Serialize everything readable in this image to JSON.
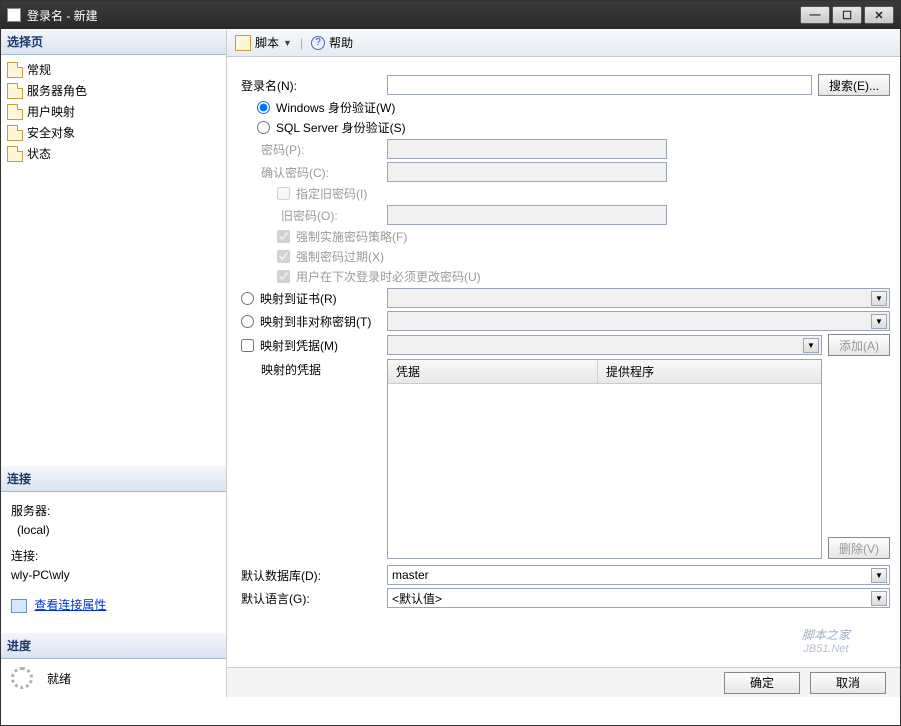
{
  "window": {
    "title": "登录名 - 新建"
  },
  "leftPanel": {
    "selectHeader": "选择页",
    "pages": [
      "常规",
      "服务器角色",
      "用户映射",
      "安全对象",
      "状态"
    ],
    "connHeader": "连接",
    "serverLabel": "服务器:",
    "serverValue": "(local)",
    "connLabel": "连接:",
    "connValue": "wly-PC\\wly",
    "viewConnProps": "查看连接属性",
    "progressHeader": "进度",
    "readyText": "就绪"
  },
  "toolbar": {
    "script": "脚本",
    "help": "帮助"
  },
  "form": {
    "loginNameLabel": "登录名(N):",
    "searchBtn": "搜索(E)...",
    "winAuth": "Windows 身份验证(W)",
    "sqlAuth": "SQL Server 身份验证(S)",
    "pwdLabel": "密码(P):",
    "confirmPwdLabel": "确认密码(C):",
    "specifyOldPwd": "指定旧密码(I)",
    "oldPwdLabel": "旧密码(O):",
    "enforcePolicy": "强制实施密码策略(F)",
    "enforceExpire": "强制密码过期(X)",
    "mustChange": "用户在下次登录时必须更改密码(U)",
    "mapCert": "映射到证书(R)",
    "mapAsymKey": "映射到非对称密钥(T)",
    "mapCred": "映射到凭据(M)",
    "addBtn": "添加(A)",
    "mappedCredsLabel": "映射的凭据",
    "credCol1": "凭据",
    "credCol2": "提供程序",
    "removeBtn": "删除(V)",
    "defaultDbLabel": "默认数据库(D):",
    "defaultDbValue": "master",
    "defaultLangLabel": "默认语言(G):",
    "defaultLangValue": "<默认值>"
  },
  "footer": {
    "ok": "确定",
    "cancel": "取消"
  },
  "watermark": {
    "line1": "脚本之家",
    "line2": "JB51.Net"
  }
}
